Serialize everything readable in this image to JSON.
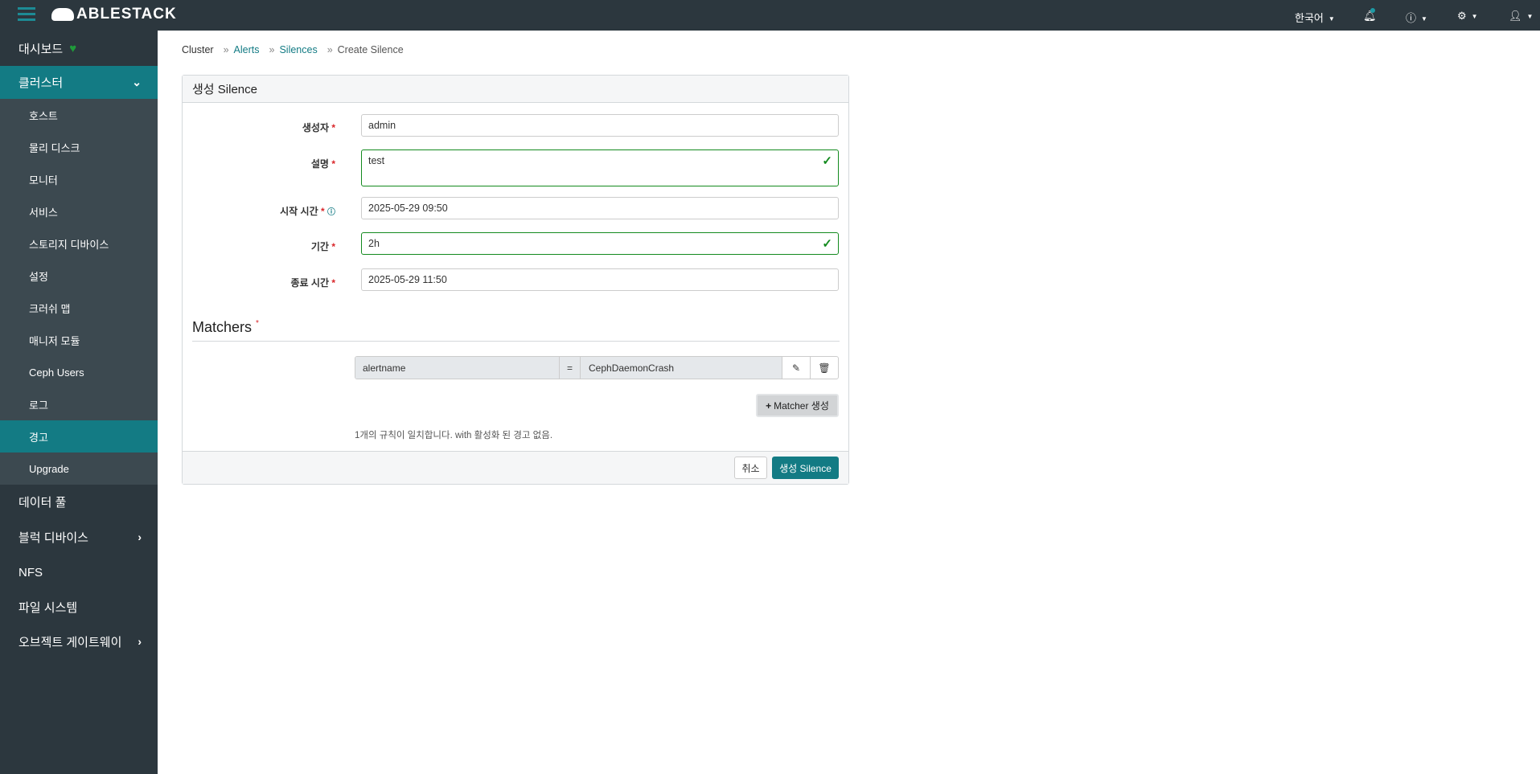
{
  "topbar": {
    "brand": "ABLESTACK",
    "language": "한국어"
  },
  "sidebar": {
    "dashboard": "대시보드",
    "cluster": "클러스터",
    "cluster_items": [
      "호스트",
      "물리 디스크",
      "모니터",
      "서비스",
      "스토리지 디바이스",
      "설정",
      "크러쉬 맵",
      "매니저 모듈",
      "Ceph Users",
      "로그",
      "경고",
      "Upgrade"
    ],
    "pools": "데이터 풀",
    "block": "블럭 디바이스",
    "nfs": "NFS",
    "filesystem": "파일 시스템",
    "object_gateway": "오브젝트 게이트웨이"
  },
  "breadcrumb": [
    "Cluster",
    "Alerts",
    "Silences",
    "Create Silence"
  ],
  "form": {
    "title": "생성 Silence",
    "creator_label": "생성자",
    "creator": "admin",
    "comment_label": "설명",
    "comment": "test",
    "start_label": "시작 시간",
    "start": "2025-05-29 09:50",
    "duration_label": "기간",
    "duration": "2h",
    "end_label": "종료 시간",
    "end": "2025-05-29 11:50",
    "required": "*",
    "matchers_title": "Matchers",
    "matcher": {
      "name": "alertname",
      "op": "=",
      "value": "CephDaemonCrash"
    },
    "add_matcher": "Matcher 생성",
    "match_info": "1개의 규칙이 일치합니다. with 활성화 된 경고 없음.",
    "cancel": "취소",
    "submit": "생성 Silence"
  },
  "colors": {
    "accent": "#137b84",
    "topbar": "#2c373e",
    "valid": "#138a1e"
  }
}
